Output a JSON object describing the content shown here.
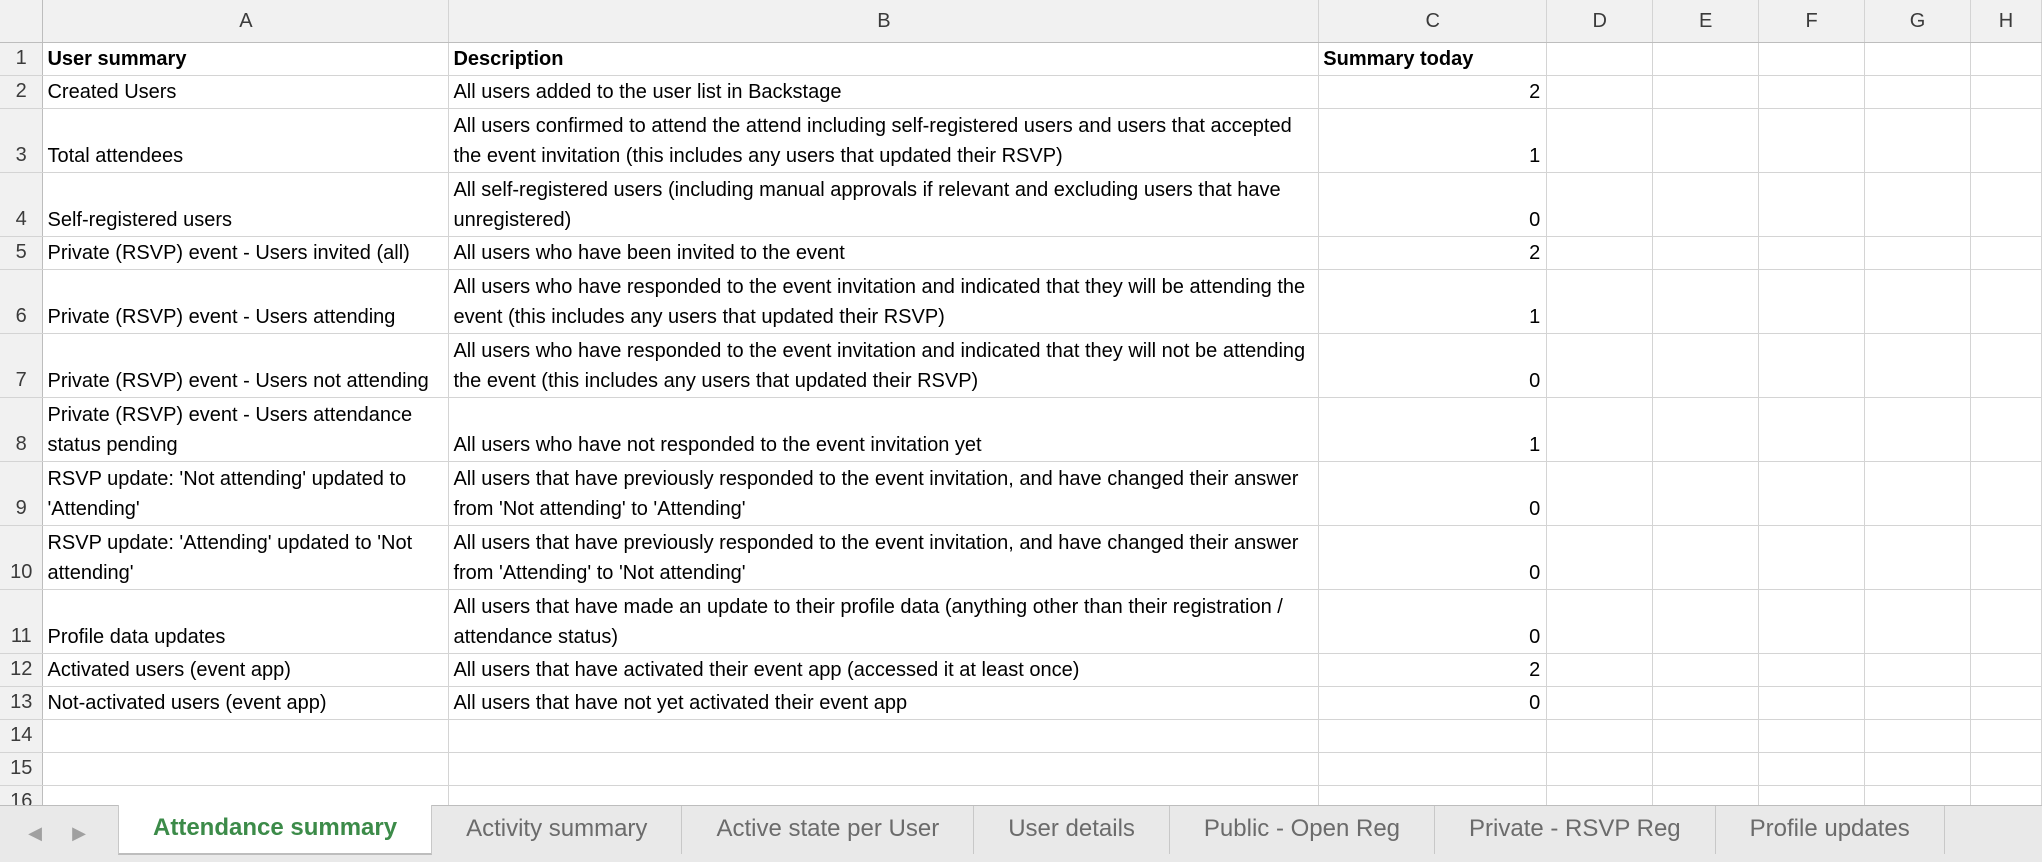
{
  "columns": [
    "A",
    "B",
    "C",
    "D",
    "E",
    "F",
    "G",
    "H"
  ],
  "rows": [
    {
      "num": "1",
      "a": "User summary",
      "b": "Description",
      "c": "Summary today"
    },
    {
      "num": "2",
      "a": "Created Users",
      "b": "All users added to the user list in Backstage",
      "c": "2"
    },
    {
      "num": "3",
      "a": "Total attendees",
      "b": "All users confirmed to attend the attend including self-registered users and users that accepted the event invitation (this includes any users that updated their RSVP)",
      "c": "1"
    },
    {
      "num": "4",
      "a": "Self-registered users",
      "b": "All self-registered users (including manual approvals if relevant and excluding users that have unregistered)",
      "c": "0"
    },
    {
      "num": "5",
      "a": "Private (RSVP) event - Users invited (all)",
      "b": "All users who have been invited to the event",
      "c": "2"
    },
    {
      "num": "6",
      "a": "Private (RSVP) event - Users attending",
      "b": "All users who have responded to the event invitation and indicated that they will be attending the event (this includes any users that updated their RSVP)",
      "c": "1"
    },
    {
      "num": "7",
      "a": "Private (RSVP) event - Users not attending",
      "b": "All users who have responded to the event invitation and indicated that they will not be attending the event (this includes any users that updated their RSVP)",
      "c": "0"
    },
    {
      "num": "8",
      "a": "Private (RSVP) event - Users attendance status pending",
      "b": "All users who have not responded to the event invitation yet",
      "c": "1"
    },
    {
      "num": "9",
      "a": "RSVP update: 'Not attending' updated to 'Attending'",
      "b": "All users that have previously responded to the event invitation, and have changed their answer from 'Not attending' to 'Attending'",
      "c": "0"
    },
    {
      "num": "10",
      "a": "RSVP update: 'Attending' updated to 'Not attending'",
      "b": "All users that have previously responded to the event invitation, and have changed their answer from 'Attending' to 'Not attending'",
      "c": "0"
    },
    {
      "num": "11",
      "a": "Profile data updates",
      "b": "All users that have made an update to their profile data (anything other than their registration / attendance status)",
      "c": "0"
    },
    {
      "num": "12",
      "a": "Activated users (event app)",
      "b": "All users that have activated their event app (accessed it at least once)",
      "c": "2"
    },
    {
      "num": "13",
      "a": "Not-activated users (event app)",
      "b": "All users that have not yet activated their event app",
      "c": "0"
    },
    {
      "num": "14",
      "a": "",
      "b": "",
      "c": ""
    },
    {
      "num": "15",
      "a": "",
      "b": "",
      "c": ""
    },
    {
      "num": "16",
      "a": "",
      "b": "",
      "c": ""
    }
  ],
  "tabs": [
    "Attendance summary",
    "Activity summary",
    "Active state per User",
    "User details",
    "Public - Open Reg",
    "Private - RSVP Reg",
    "Profile updates"
  ],
  "active_tab": "Attendance summary",
  "icons": {
    "prev": "chevron-left-icon",
    "next": "chevron-right-icon"
  },
  "colors": {
    "active_tab": "#3c8b49",
    "header_bg": "#f1f1f1",
    "grid": "#d4d4d4"
  }
}
